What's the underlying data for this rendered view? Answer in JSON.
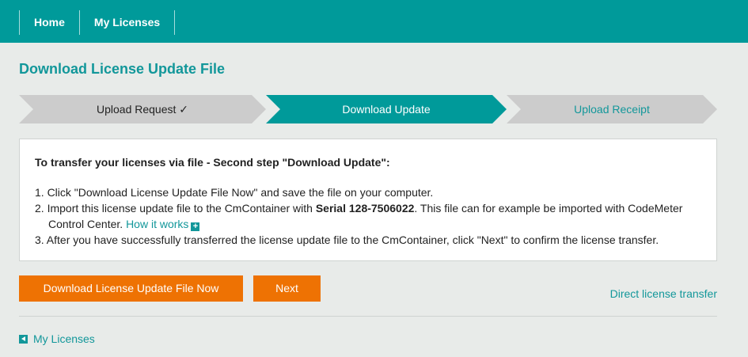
{
  "nav": {
    "items": [
      {
        "label": "Home"
      },
      {
        "label": "My Licenses"
      }
    ]
  },
  "page": {
    "title": "Download License Update File"
  },
  "steps": [
    {
      "label": "Upload Request ✓",
      "state": "completed"
    },
    {
      "label": "Download Update",
      "state": "active"
    },
    {
      "label": "Upload Receipt",
      "state": "upcoming"
    }
  ],
  "instructions": {
    "heading": "To transfer your licenses via file - Second step \"Download Update\":",
    "step1": "1. Click \"Download License Update File Now\" and save the file on your computer.",
    "step2_prefix": "2. Import this license update file to the CmContainer with ",
    "step2_serial": "Serial 128-7506022",
    "step2_suffix": ". This file can for example be imported with CodeMeter Control Center. ",
    "step2_link": "How it works",
    "step3": "3. After you have successfully transferred the license update file to the CmContainer, click \"Next\" to confirm the license transfer."
  },
  "buttons": {
    "download": "Download License Update File Now",
    "next": "Next"
  },
  "links": {
    "direct_transfer": "Direct license transfer",
    "back": "My Licenses"
  },
  "colors": {
    "brand_teal": "#009a9a",
    "link_teal": "#12979a",
    "accent_orange": "#ee7203",
    "step_inactive": "#cccccc",
    "page_bg": "#e8ebe9"
  },
  "icons": {
    "expand": "plus-icon",
    "back": "arrow-left-icon"
  }
}
